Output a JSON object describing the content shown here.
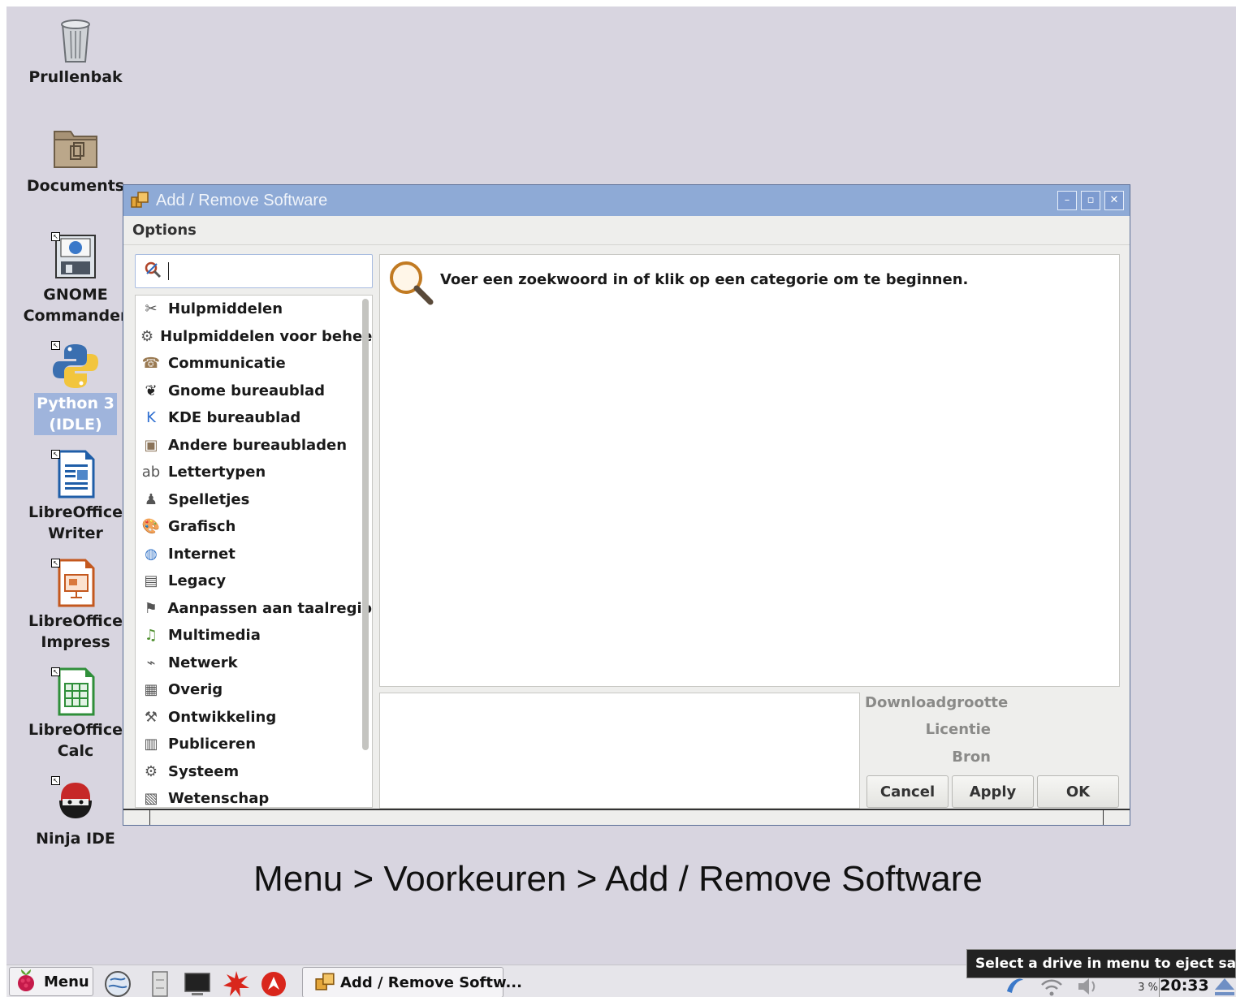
{
  "desktop": {
    "icons": [
      {
        "label": "Prullenbak",
        "icon": "trash-icon"
      },
      {
        "label": "Documents",
        "icon": "folder-icon"
      },
      {
        "label": "GNOME\nCommander",
        "icon": "gnome-commander-icon"
      },
      {
        "label": "Python 3\n(IDLE)",
        "icon": "python-icon",
        "selected": true
      },
      {
        "label": "LibreOffice\nWriter",
        "icon": "writer-icon"
      },
      {
        "label": "LibreOffice\nImpress",
        "icon": "impress-icon"
      },
      {
        "label": "LibreOffice\nCalc",
        "icon": "calc-icon"
      },
      {
        "label": "Ninja IDE",
        "icon": "ninja-ide-icon"
      }
    ]
  },
  "window": {
    "title": "Add / Remove Software",
    "menu": {
      "options": "Options"
    },
    "search": {
      "value": ""
    },
    "categories": [
      {
        "label": "Hulpmiddelen",
        "icon": "accessories-icon"
      },
      {
        "label": "Hulpmiddelen voor beheer",
        "icon": "admin-tools-icon"
      },
      {
        "label": "Communicatie",
        "icon": "communication-icon"
      },
      {
        "label": "Gnome bureaublad",
        "icon": "gnome-foot-icon"
      },
      {
        "label": "KDE bureaublad",
        "icon": "kde-icon"
      },
      {
        "label": "Andere bureaubladen",
        "icon": "other-desktops-icon"
      },
      {
        "label": "Lettertypen",
        "icon": "fonts-icon"
      },
      {
        "label": "Spelletjes",
        "icon": "games-icon"
      },
      {
        "label": "Grafisch",
        "icon": "graphics-icon"
      },
      {
        "label": "Internet",
        "icon": "internet-icon"
      },
      {
        "label": "Legacy",
        "icon": "floppy-icon"
      },
      {
        "label": "Aanpassen aan taalregio",
        "icon": "localization-icon"
      },
      {
        "label": "Multimedia",
        "icon": "multimedia-icon"
      },
      {
        "label": "Netwerk",
        "icon": "network-icon"
      },
      {
        "label": "Overig",
        "icon": "other-icon"
      },
      {
        "label": "Ontwikkeling",
        "icon": "development-icon"
      },
      {
        "label": "Publiceren",
        "icon": "publishing-icon"
      },
      {
        "label": "Systeem",
        "icon": "system-icon"
      },
      {
        "label": "Wetenschap",
        "icon": "science-icon"
      }
    ],
    "hint": "Voer een zoekwoord in of klik op een categorie om te beginnen.",
    "info": {
      "download_size": "Downloadgrootte",
      "license": "Licentie",
      "source": "Bron"
    },
    "buttons": {
      "cancel": "Cancel",
      "apply": "Apply",
      "ok": "OK"
    }
  },
  "caption": "Menu > Voorkeuren > Add / Remove Software",
  "taskbar": {
    "menu_label": "Menu",
    "task_label": "Add / Remove Softw...",
    "tooltip": "Select a drive in menu to eject safely",
    "cpu": "3 %",
    "clock": "20:33"
  },
  "colors": {
    "desktop_bg": "#d8d5e0",
    "titlebar": "#8eaad6",
    "window_bg": "#eeeeec"
  }
}
